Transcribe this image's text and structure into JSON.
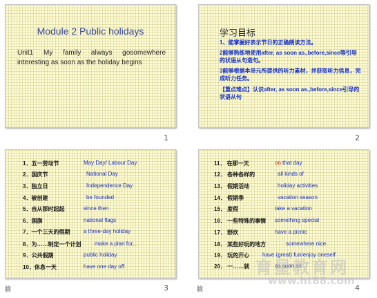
{
  "slides": [
    {
      "number": "1",
      "title": "Module 2 Public holidays",
      "body": "Unit1  My  family  always  gosomewhere interesting as soon as the holiday begins"
    },
    {
      "number": "2",
      "title": "学习目标",
      "objectives": [
        "1、能掌握好表示节日的正确朗读方法。",
        "2能够熟练地使用after, as soon as.,before,since等引导的状语从句造句。",
        "3能够根据本单元所提供的听力素材，并获取听力信息，完成听力任务。",
        "【重点难点】认识after, as soon as.,before,since引导的状语从句"
      ]
    },
    {
      "number": "3",
      "animation_icon": "臉",
      "rows": [
        {
          "zh": "1．五一劳动节",
          "en": "May Day/ Labour Day"
        },
        {
          "zh": "2．国庆节",
          "en": "National Day"
        },
        {
          "zh": "3．独立日",
          "en": "Independence  Day"
        },
        {
          "zh": "4．被创建",
          "en": "be founded"
        },
        {
          "zh": "5．自从那时起起",
          "en": "since then"
        },
        {
          "zh": "6．国旗",
          "en": "national flags"
        },
        {
          "zh": "7．一个三天的假期",
          "en": "a three-day holiday"
        },
        {
          "zh": "8．为……制定一个计划",
          "en": "make a plan  for…"
        },
        {
          "zh": "9．公共假期",
          "en": "public holiday"
        },
        {
          "zh": "10．休息一天",
          "en": "have one day off"
        }
      ]
    },
    {
      "number": "4",
      "animation_icon": "臉",
      "rows": [
        {
          "zh": "11．  在那一天",
          "en_pre": "",
          "en_hl": "on",
          "en": " that day"
        },
        {
          "zh": "12．  各种各样的",
          "en_pre": "",
          "en_hl": "",
          "en": "all kinds of"
        },
        {
          "zh": "13．  假期活动",
          "en_pre": "",
          "en_hl": "",
          "en": "holiday activities"
        },
        {
          "zh": "14．  假期季",
          "en_pre": "",
          "en_hl": "",
          "en": "vacation season"
        },
        {
          "zh": "15．  度假",
          "en_pre": "",
          "en_hl": "",
          "en": "take a vacation"
        },
        {
          "zh": "16．  一些特殊的事情",
          "en_pre": "",
          "en_hl": "",
          "en": "something special"
        },
        {
          "zh": "17．  野炊",
          "en_pre": "",
          "en_hl": "",
          "en": "have a picnic"
        },
        {
          "zh": "18．  某些好玩的地方",
          "en_pre": "",
          "en_hl": "",
          "en": "somewhere nice"
        },
        {
          "zh": "19．  玩的开心",
          "en_pre": "",
          "en_hl": "",
          "en": "have (great) fun/enjoy oneself"
        },
        {
          "zh": "20．  一……就",
          "en_pre": "",
          "en_hl": "",
          "en": "as soon as"
        }
      ]
    }
  ],
  "watermark": {
    "line1": "育星教育网",
    "line2": "www.ht88.com"
  }
}
